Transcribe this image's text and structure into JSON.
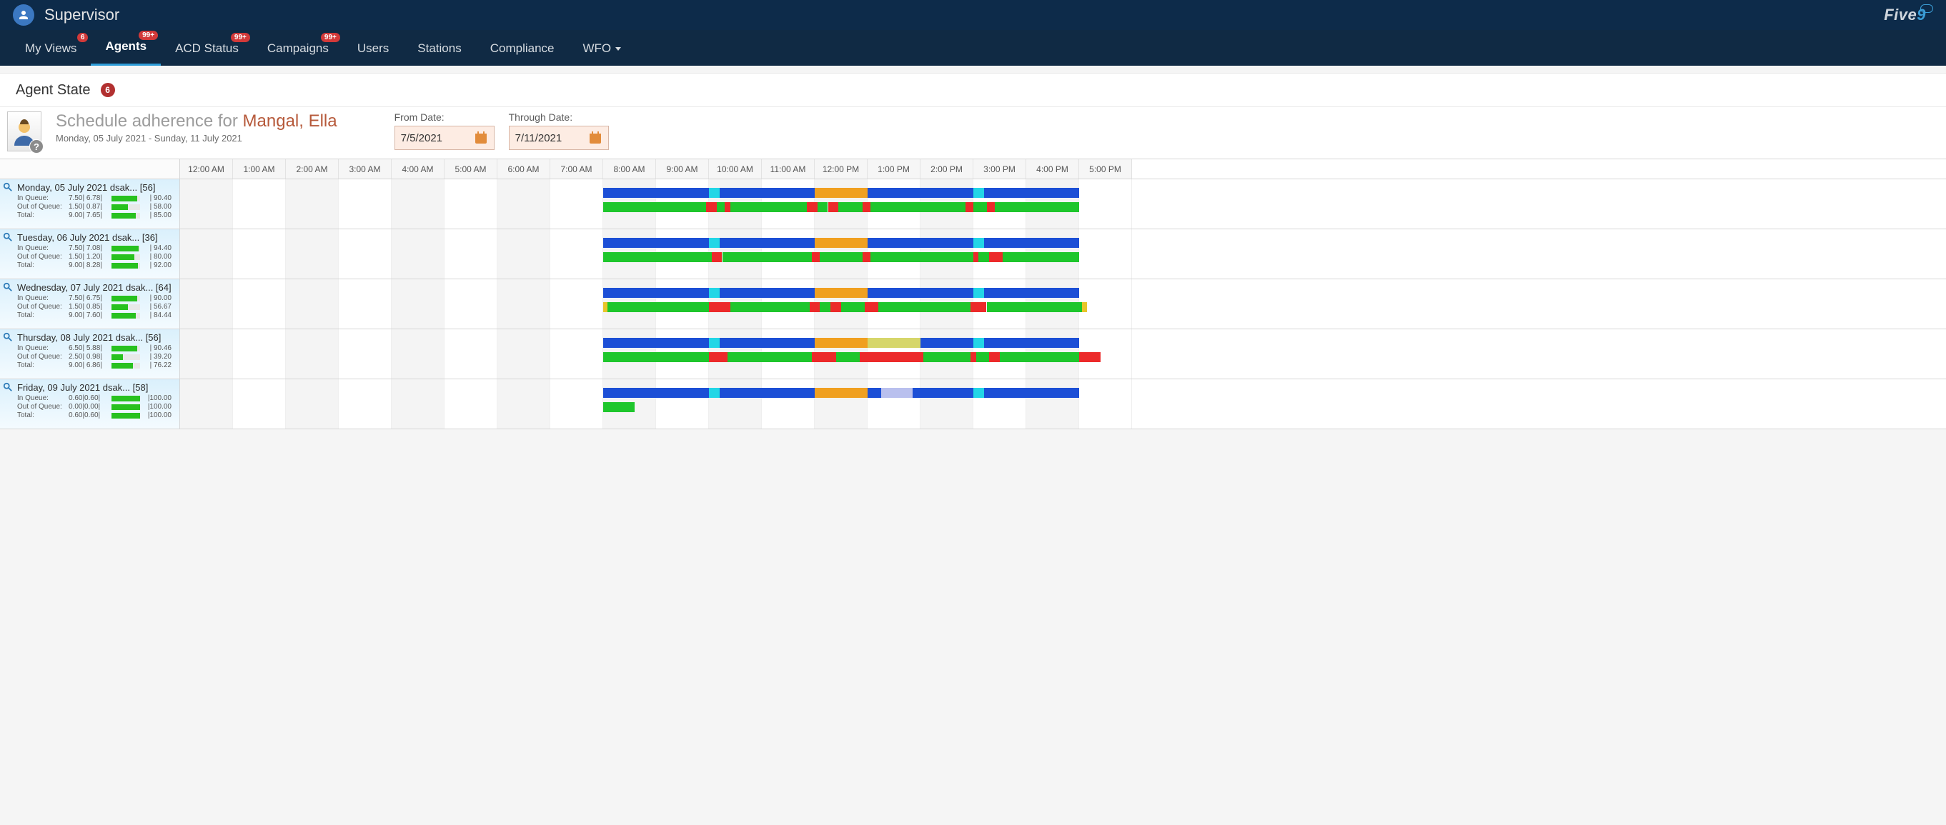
{
  "topbar": {
    "title": "Supervisor",
    "logo_main": "Five",
    "logo_accent": "9"
  },
  "nav": {
    "items": [
      {
        "label": "My Views",
        "badge": "6"
      },
      {
        "label": "Agents",
        "badge": "99+",
        "active": true
      },
      {
        "label": "ACD Status",
        "badge": "99+"
      },
      {
        "label": "Campaigns",
        "badge": "99+"
      },
      {
        "label": "Users"
      },
      {
        "label": "Stations"
      },
      {
        "label": "Compliance"
      },
      {
        "label": "WFO",
        "dropdown": true
      }
    ]
  },
  "page": {
    "title": "Agent State",
    "badge": "6"
  },
  "schedule": {
    "heading_prefix": "Schedule adherence for",
    "agent_name": "Mangal, Ella",
    "range_text": "Monday, 05 July 2021 - Sunday, 11 July 2021",
    "from_label": "From Date:",
    "from_value": "7/5/2021",
    "through_label": "Through Date:",
    "through_value": "7/11/2021"
  },
  "hours": [
    "12:00 AM",
    "1:00 AM",
    "2:00 AM",
    "3:00 AM",
    "4:00 AM",
    "5:00 AM",
    "6:00 AM",
    "7:00 AM",
    "8:00 AM",
    "9:00 AM",
    "10:00 AM",
    "11:00 AM",
    "12:00 PM",
    "1:00 PM",
    "2:00 PM",
    "3:00 PM",
    "4:00 PM",
    "5:00 PM"
  ],
  "days": [
    {
      "title": "Monday, 05 July 2021 dsak...  [56]",
      "stats": [
        {
          "lbl": "In Queue:",
          "nums": "7.50| 6.78|",
          "bar": 90,
          "pct": "| 90.40"
        },
        {
          "lbl": "Out of Queue:",
          "nums": "1.50| 0.87|",
          "bar": 58,
          "pct": "| 58.00"
        },
        {
          "lbl": "Total:",
          "nums": "9.00| 7.65|",
          "bar": 85,
          "pct": "| 85.00"
        }
      ],
      "sched": [
        {
          "c": "blue",
          "s": 8.0,
          "e": 10.0
        },
        {
          "c": "cyan",
          "s": 10.0,
          "e": 10.2
        },
        {
          "c": "blue",
          "s": 10.2,
          "e": 12.0
        },
        {
          "c": "orange",
          "s": 12.0,
          "e": 13.0
        },
        {
          "c": "blue",
          "s": 13.0,
          "e": 15.0
        },
        {
          "c": "cyan",
          "s": 15.0,
          "e": 15.2
        },
        {
          "c": "blue",
          "s": 15.2,
          "e": 17.0
        }
      ],
      "act": [
        {
          "c": "green",
          "s": 8.0,
          "e": 9.95
        },
        {
          "c": "red",
          "s": 9.95,
          "e": 10.15
        },
        {
          "c": "green",
          "s": 10.15,
          "e": 10.3
        },
        {
          "c": "red",
          "s": 10.3,
          "e": 10.4
        },
        {
          "c": "green",
          "s": 10.4,
          "e": 11.85
        },
        {
          "c": "red",
          "s": 11.85,
          "e": 12.05
        },
        {
          "c": "green",
          "s": 12.05,
          "e": 12.25
        },
        {
          "c": "red",
          "s": 12.25,
          "e": 12.45
        },
        {
          "c": "green",
          "s": 12.45,
          "e": 12.9
        },
        {
          "c": "red",
          "s": 12.9,
          "e": 13.05
        },
        {
          "c": "green",
          "s": 13.05,
          "e": 14.85
        },
        {
          "c": "red",
          "s": 14.85,
          "e": 15.0
        },
        {
          "c": "green",
          "s": 15.0,
          "e": 15.25
        },
        {
          "c": "red",
          "s": 15.25,
          "e": 15.4
        },
        {
          "c": "green",
          "s": 15.4,
          "e": 17.0
        }
      ]
    },
    {
      "title": "Tuesday, 06 July 2021 dsak...  [36]",
      "stats": [
        {
          "lbl": "In Queue:",
          "nums": "7.50| 7.08|",
          "bar": 94,
          "pct": "| 94.40"
        },
        {
          "lbl": "Out of Queue:",
          "nums": "1.50| 1.20|",
          "bar": 80,
          "pct": "| 80.00"
        },
        {
          "lbl": "Total:",
          "nums": "9.00| 8.28|",
          "bar": 92,
          "pct": "| 92.00"
        }
      ],
      "sched": [
        {
          "c": "blue",
          "s": 8.0,
          "e": 10.0
        },
        {
          "c": "cyan",
          "s": 10.0,
          "e": 10.2
        },
        {
          "c": "blue",
          "s": 10.2,
          "e": 12.0
        },
        {
          "c": "orange",
          "s": 12.0,
          "e": 13.0
        },
        {
          "c": "blue",
          "s": 13.0,
          "e": 15.0
        },
        {
          "c": "cyan",
          "s": 15.0,
          "e": 15.2
        },
        {
          "c": "blue",
          "s": 15.2,
          "e": 17.0
        }
      ],
      "act": [
        {
          "c": "green",
          "s": 8.0,
          "e": 10.05
        },
        {
          "c": "red",
          "s": 10.05,
          "e": 10.25
        },
        {
          "c": "green",
          "s": 10.25,
          "e": 11.95
        },
        {
          "c": "red",
          "s": 11.95,
          "e": 12.1
        },
        {
          "c": "green",
          "s": 12.1,
          "e": 12.9
        },
        {
          "c": "red",
          "s": 12.9,
          "e": 13.05
        },
        {
          "c": "green",
          "s": 13.05,
          "e": 15.0
        },
        {
          "c": "red",
          "s": 15.0,
          "e": 15.1
        },
        {
          "c": "green",
          "s": 15.1,
          "e": 15.3
        },
        {
          "c": "red",
          "s": 15.3,
          "e": 15.55
        },
        {
          "c": "green",
          "s": 15.55,
          "e": 17.0
        }
      ]
    },
    {
      "title": "Wednesday, 07 July 2021 dsak...  [64]",
      "stats": [
        {
          "lbl": "In Queue:",
          "nums": "7.50| 6.75|",
          "bar": 90,
          "pct": "| 90.00"
        },
        {
          "lbl": "Out of Queue:",
          "nums": "1.50| 0.85|",
          "bar": 57,
          "pct": "| 56.67"
        },
        {
          "lbl": "Total:",
          "nums": "9.00| 7.60|",
          "bar": 84,
          "pct": "| 84.44"
        }
      ],
      "sched": [
        {
          "c": "blue",
          "s": 8.0,
          "e": 10.0
        },
        {
          "c": "cyan",
          "s": 10.0,
          "e": 10.2
        },
        {
          "c": "blue",
          "s": 10.2,
          "e": 12.0
        },
        {
          "c": "orange",
          "s": 12.0,
          "e": 13.0
        },
        {
          "c": "blue",
          "s": 13.0,
          "e": 15.0
        },
        {
          "c": "cyan",
          "s": 15.0,
          "e": 15.2
        },
        {
          "c": "blue",
          "s": 15.2,
          "e": 17.0
        }
      ],
      "act": [
        {
          "c": "yel",
          "s": 8.0,
          "e": 8.08
        },
        {
          "c": "green",
          "s": 8.08,
          "e": 10.0
        },
        {
          "c": "red",
          "s": 10.0,
          "e": 10.4
        },
        {
          "c": "green",
          "s": 10.4,
          "e": 11.9
        },
        {
          "c": "red",
          "s": 11.9,
          "e": 12.1
        },
        {
          "c": "green",
          "s": 12.1,
          "e": 12.3
        },
        {
          "c": "red",
          "s": 12.3,
          "e": 12.5
        },
        {
          "c": "green",
          "s": 12.5,
          "e": 12.95
        },
        {
          "c": "red",
          "s": 12.95,
          "e": 13.2
        },
        {
          "c": "green",
          "s": 13.2,
          "e": 14.95
        },
        {
          "c": "red",
          "s": 14.95,
          "e": 15.25
        },
        {
          "c": "green",
          "s": 15.25,
          "e": 17.05
        },
        {
          "c": "yel",
          "s": 17.05,
          "e": 17.15
        }
      ]
    },
    {
      "title": "Thursday, 08 July 2021 dsak...  [56]",
      "stats": [
        {
          "lbl": "In Queue:",
          "nums": "6.50| 5.88|",
          "bar": 90,
          "pct": "| 90.46"
        },
        {
          "lbl": "Out of Queue:",
          "nums": "2.50| 0.98|",
          "bar": 39,
          "pct": "| 39.20"
        },
        {
          "lbl": "Total:",
          "nums": "9.00| 6.86|",
          "bar": 76,
          "pct": "| 76.22"
        }
      ],
      "sched": [
        {
          "c": "blue",
          "s": 8.0,
          "e": 10.0
        },
        {
          "c": "cyan",
          "s": 10.0,
          "e": 10.2
        },
        {
          "c": "blue",
          "s": 10.2,
          "e": 12.0
        },
        {
          "c": "orange",
          "s": 12.0,
          "e": 13.0
        },
        {
          "c": "khaki",
          "s": 13.0,
          "e": 14.0
        },
        {
          "c": "blue",
          "s": 14.0,
          "e": 15.0
        },
        {
          "c": "cyan",
          "s": 15.0,
          "e": 15.2
        },
        {
          "c": "blue",
          "s": 15.2,
          "e": 17.0
        }
      ],
      "act": [
        {
          "c": "green",
          "s": 8.0,
          "e": 10.0
        },
        {
          "c": "red",
          "s": 10.0,
          "e": 10.35
        },
        {
          "c": "green",
          "s": 10.35,
          "e": 11.95
        },
        {
          "c": "red",
          "s": 11.95,
          "e": 12.4
        },
        {
          "c": "green",
          "s": 12.4,
          "e": 12.85
        },
        {
          "c": "red",
          "s": 12.85,
          "e": 14.05
        },
        {
          "c": "green",
          "s": 14.05,
          "e": 14.95
        },
        {
          "c": "red",
          "s": 14.95,
          "e": 15.05
        },
        {
          "c": "green",
          "s": 15.05,
          "e": 15.3
        },
        {
          "c": "red",
          "s": 15.3,
          "e": 15.5
        },
        {
          "c": "green",
          "s": 15.5,
          "e": 17.0
        },
        {
          "c": "red",
          "s": 17.0,
          "e": 17.4
        }
      ]
    },
    {
      "title": "Friday, 09 July 2021  dsak...  [58]",
      "stats": [
        {
          "lbl": "In Queue:",
          "nums": "0.60|0.60|",
          "bar": 100,
          "pct": "|100.00"
        },
        {
          "lbl": "Out of Queue:",
          "nums": "0.00|0.00|",
          "bar": 100,
          "pct": "|100.00"
        },
        {
          "lbl": "Total:",
          "nums": "0.60|0.60|",
          "bar": 100,
          "pct": "|100.00"
        }
      ],
      "sched": [
        {
          "c": "blue",
          "s": 8.0,
          "e": 10.0
        },
        {
          "c": "cyan",
          "s": 10.0,
          "e": 10.2
        },
        {
          "c": "blue",
          "s": 10.2,
          "e": 12.0
        },
        {
          "c": "orange",
          "s": 12.0,
          "e": 13.0
        },
        {
          "c": "blue",
          "s": 13.0,
          "e": 13.25
        },
        {
          "c": "lav",
          "s": 13.25,
          "e": 13.85
        },
        {
          "c": "blue",
          "s": 13.85,
          "e": 15.0
        },
        {
          "c": "cyan",
          "s": 15.0,
          "e": 15.2
        },
        {
          "c": "blue",
          "s": 15.2,
          "e": 17.0
        }
      ],
      "act": [
        {
          "c": "green",
          "s": 8.0,
          "e": 8.6
        }
      ]
    }
  ]
}
